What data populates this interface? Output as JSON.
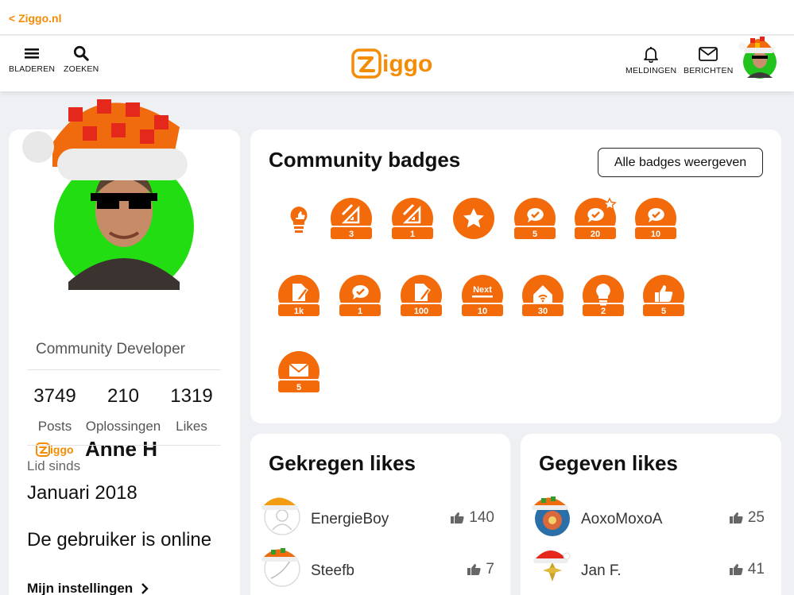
{
  "topbar": {
    "back_label": "< Ziggo.nl"
  },
  "nav": {
    "browse_label": "BLADEREN",
    "search_label": "ZOEKEN",
    "notifications_label": "MELDINGEN",
    "messages_label": "BERICHTEN"
  },
  "brand": {
    "logo_text": "ziggo",
    "accent": "#f48c06",
    "badge_orange": "#f26a0a"
  },
  "profile": {
    "name": "Anne H",
    "role": "Community Developer",
    "stats": [
      {
        "value": "3749",
        "label": "Posts"
      },
      {
        "value": "210",
        "label": "Oplossingen"
      },
      {
        "value": "1319",
        "label": "Likes"
      }
    ],
    "member_since_label": "Lid sinds",
    "member_since_value": "Januari 2018",
    "online_status": "De gebruiker is online",
    "settings_label": "Mijn instellingen"
  },
  "badges": {
    "title": "Community badges",
    "all_button": "Alle badges weergeven",
    "rows": [
      [
        {
          "icon": "lightbulb-like-icon",
          "label": ""
        },
        {
          "icon": "ruler-triangle-icon",
          "label": "3"
        },
        {
          "icon": "ruler-triangle-icon",
          "label": "1"
        },
        {
          "icon": "star-icon",
          "label": ""
        },
        {
          "icon": "speech-check-icon",
          "label": "5"
        },
        {
          "icon": "speech-check-star-icon",
          "label": "20"
        },
        {
          "icon": "speech-check-icon",
          "label": "10"
        }
      ],
      [
        {
          "icon": "document-edit-icon",
          "label": "1k"
        },
        {
          "icon": "speech-check-icon",
          "label": "1"
        },
        {
          "icon": "document-edit-icon",
          "label": "100"
        },
        {
          "icon": "next-icon",
          "label": "10"
        },
        {
          "icon": "home-wifi-icon",
          "label": "30"
        },
        {
          "icon": "lightbulb-icon",
          "label": "2"
        },
        {
          "icon": "thumbs-up-icon",
          "label": "5"
        }
      ],
      [
        {
          "icon": "envelope-icon",
          "label": "5"
        }
      ]
    ],
    "next_text": "Next"
  },
  "received": {
    "title": "Gekregen likes",
    "rows": [
      {
        "user": "EnergieBoy",
        "count": "140"
      },
      {
        "user": "Steefb",
        "count": "7"
      }
    ]
  },
  "given": {
    "title": "Gegeven likes",
    "rows": [
      {
        "user": "AoxoMoxoA",
        "count": "25"
      },
      {
        "user": "Jan F.",
        "count": "41"
      }
    ]
  }
}
